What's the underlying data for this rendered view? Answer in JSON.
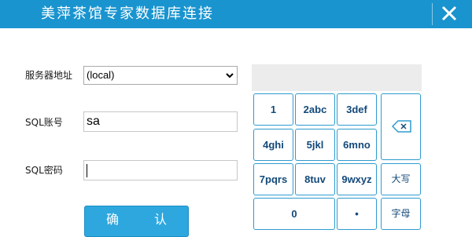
{
  "window": {
    "title": "美萍茶馆专家数据库连接",
    "close_icon": "close-icon",
    "accent_color": "#1994cf"
  },
  "form": {
    "server_label": "服务器地址",
    "server_value": "(local)",
    "sql_account_label": "SQL账号",
    "sql_account_value": "sa",
    "sql_password_label": "SQL密码",
    "sql_password_value": "",
    "confirm_label": "确 认"
  },
  "keypad": {
    "keys": {
      "k1": "1",
      "k2": "2abc",
      "k3": "3def",
      "k4": "4ghi",
      "k5": "5jkl",
      "k6": "6mno",
      "k7": "7pqrs",
      "k8": "8tuv",
      "k9": "9wxyz",
      "k0": "0",
      "dot": "•",
      "caps": "大写",
      "letters": "字母",
      "backspace_icon": "backspace-icon"
    }
  }
}
